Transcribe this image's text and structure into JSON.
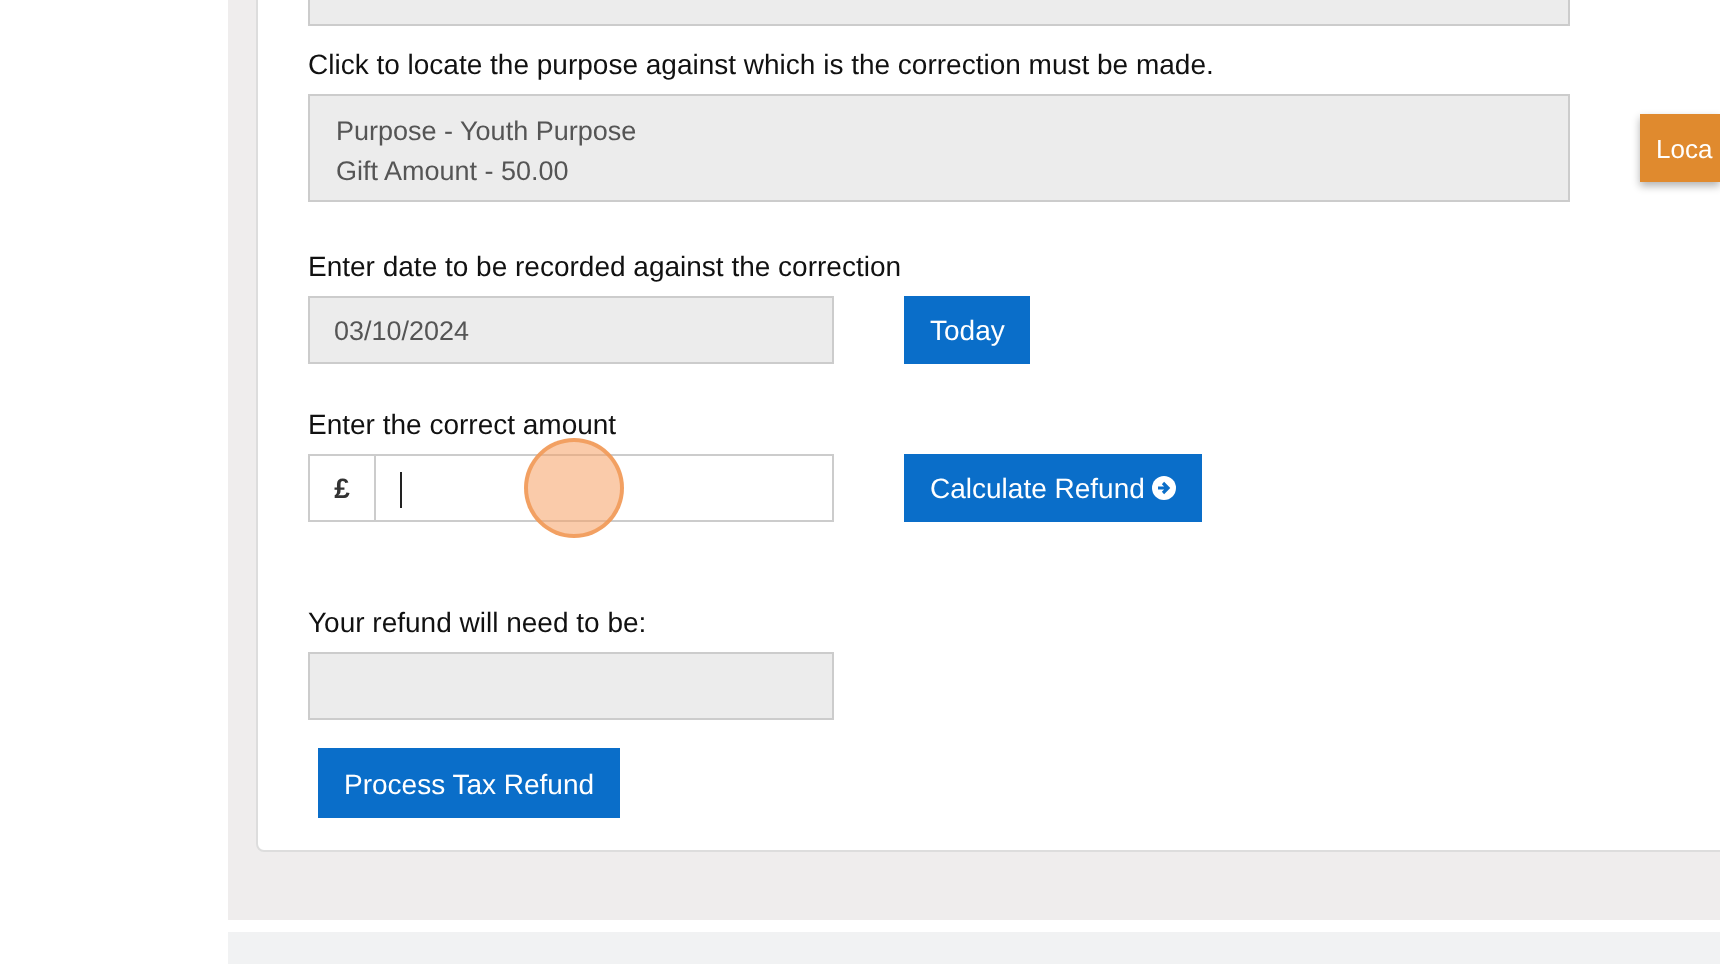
{
  "purpose_prompt": "Click to locate the purpose against which is the correction must be made.",
  "purpose_box": {
    "lines": [
      "Purpose - Youth Purpose",
      "Gift Amount - 50.00"
    ]
  },
  "locate_button": {
    "label": "Loca"
  },
  "date_label": "Enter date to be recorded against the correction",
  "date_field": {
    "value": "03/10/2024"
  },
  "today_button": {
    "label": "Today"
  },
  "amount_label": "Enter the correct amount",
  "amount_field": {
    "currency_symbol": "£"
  },
  "calculate_button": {
    "label": "Calculate Refund"
  },
  "refund_label": "Your refund will need to be:",
  "process_button": {
    "label": "Process Tax Refund"
  }
}
